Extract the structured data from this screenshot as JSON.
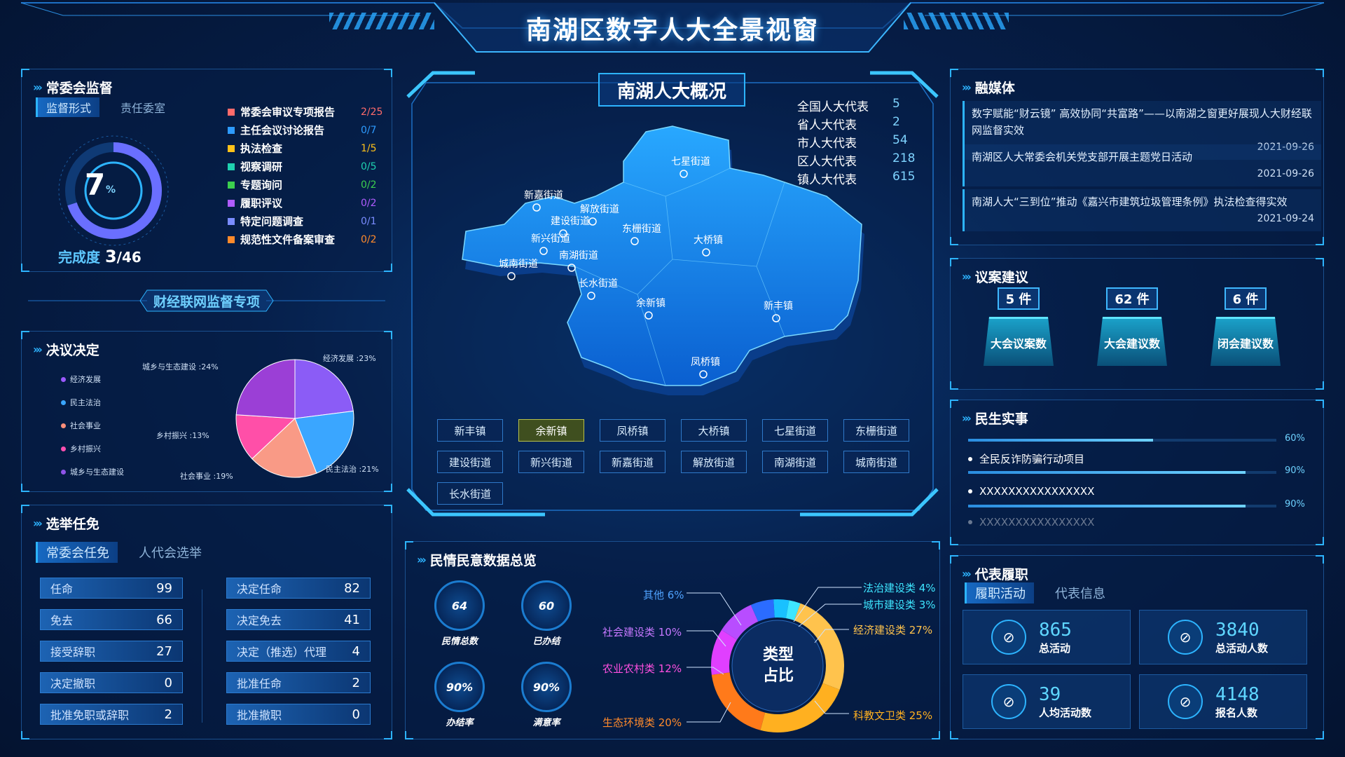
{
  "header": {
    "title": "南湖区数字人大全景视窗"
  },
  "supervision": {
    "title": "常委会监督",
    "tab_active": "监督形式",
    "tab_other": "责任委室",
    "ring_value": "7",
    "ring_unit": "%",
    "ring_percent": 7,
    "completion_label": "完成度",
    "completion_done": "3",
    "completion_total": "/46",
    "items": [
      {
        "label": "常委会审议专项报告",
        "value": "2/25",
        "color": "#ff6b6b"
      },
      {
        "label": "主任会议讨论报告",
        "value": "0/7",
        "color": "#2d9bff"
      },
      {
        "label": "执法检查",
        "value": "1/5",
        "color": "#ffc21a"
      },
      {
        "label": "视察调研",
        "value": "0/5",
        "color": "#1fd1b0"
      },
      {
        "label": "专题询问",
        "value": "0/2",
        "color": "#3ccf4e"
      },
      {
        "label": "履职评议",
        "value": "0/2",
        "color": "#b05cff"
      },
      {
        "label": "特定问题调查",
        "value": "0/1",
        "color": "#7a8cff"
      },
      {
        "label": "规范性文件备案审查",
        "value": "0/2",
        "color": "#ff8a2b"
      }
    ]
  },
  "special_banner": {
    "label": "财经联网监督专项"
  },
  "resolutions": {
    "title": "决议决定",
    "legend": [
      {
        "label": "经济发展",
        "color": "#9b59ff"
      },
      {
        "label": "民主法治",
        "color": "#3aa6ff"
      },
      {
        "label": "社会事业",
        "color": "#ff8f7a"
      },
      {
        "label": "乡村振兴",
        "color": "#ff4fb0"
      },
      {
        "label": "城乡与生态建设",
        "color": "#8f54e8"
      }
    ],
    "pie_labels": {
      "a": "经济发展 :23%",
      "b": "民主法治 :21%",
      "c": "社会事业 :19%",
      "d": "乡村振兴 :13%",
      "e": "城乡与生态建设 :24%"
    }
  },
  "chart_data": [
    {
      "type": "pie",
      "categories": [
        "经济发展",
        "民主法治",
        "社会事业",
        "乡村振兴",
        "城乡与生态建设"
      ],
      "values": [
        23,
        21,
        19,
        13,
        24
      ],
      "colors": [
        "#8b5cf6",
        "#3aa6ff",
        "#f99a86",
        "#ff4fa8",
        "#9b3fd6"
      ]
    },
    {
      "type": "pie",
      "categories": [
        "经济建设类",
        "科教文卫类",
        "生态环境类",
        "农业农村类",
        "社会建设类",
        "其他",
        "法治建设类",
        "城市建设类"
      ],
      "values": [
        27,
        25,
        20,
        12,
        10,
        6,
        4,
        3
      ],
      "colors": [
        "#ffc34d",
        "#ffb020",
        "#ff7a1a",
        "#e03fff",
        "#b84dff",
        "#2b6cff",
        "#19c1ff",
        "#3ee6ff"
      ]
    }
  ],
  "elections": {
    "title": "选举任免",
    "tab_active": "常委会任免",
    "tab_other": "人代会选举",
    "left": [
      {
        "label": "任命",
        "value": "99"
      },
      {
        "label": "免去",
        "value": "66"
      },
      {
        "label": "接受辞职",
        "value": "27"
      },
      {
        "label": "决定撤职",
        "value": "0"
      },
      {
        "label": "批准免职或辞职",
        "value": "2"
      }
    ],
    "right": [
      {
        "label": "决定任命",
        "value": "82"
      },
      {
        "label": "决定免去",
        "value": "41"
      },
      {
        "label": "决定（推选）代理",
        "value": "4"
      },
      {
        "label": "批准任命",
        "value": "2"
      },
      {
        "label": "批准撤职",
        "value": "0"
      }
    ]
  },
  "overview": {
    "title": "南湖人大概况",
    "reps": [
      {
        "label": "全国人大代表",
        "value": "5"
      },
      {
        "label": "省人大代表",
        "value": "2"
      },
      {
        "label": "市人大代表",
        "value": "54"
      },
      {
        "label": "区人大代表",
        "value": "218"
      },
      {
        "label": "镇人大代表",
        "value": "615"
      }
    ],
    "map_places": [
      "七星街道",
      "新嘉街道",
      "解放街道",
      "建设街道",
      "东栅街道",
      "新兴街道",
      "大桥镇",
      "南湖街道",
      "城南街道",
      "长水街道",
      "余新镇",
      "新丰镇",
      "凤桥镇"
    ],
    "buttons": [
      "新丰镇",
      "余新镇",
      "凤桥镇",
      "大桥镇",
      "七星街道",
      "东栅街道",
      "建设街道",
      "新兴街道",
      "新嘉街道",
      "解放街道",
      "南湖街道",
      "城南街道",
      "长水街道"
    ]
  },
  "public_opinion": {
    "title": "民情民意数据总览",
    "kpis": [
      {
        "value": "64",
        "label": "民情总数"
      },
      {
        "value": "60",
        "label": "已办结"
      },
      {
        "value": "90%",
        "label": "办结率"
      },
      {
        "value": "90%",
        "label": "满意率"
      }
    ],
    "donut_center_1": "类型",
    "donut_center_2": "占比",
    "labels": {
      "l1": "其他 6%",
      "l2": "社会建设类 10%",
      "l3": "农业农村类 12%",
      "l4": "生态环境类 20%",
      "r1": "法治建设类 4%",
      "r2": "城市建设类 3%",
      "r3": "经济建设类 27%",
      "r4": "科教文卫类 25%"
    }
  },
  "media": {
    "title": "融媒体",
    "news": [
      {
        "text": "数字赋能“财云镜” 高效协同“共富路”——以南湖之窗更好展现人大财经联网监督实效",
        "date": "2021-09-26"
      },
      {
        "text": "南湖区人大常委会机关党支部开展主题党日活动",
        "date": "2021-09-26"
      },
      {
        "text": "南湖人大“三到位”推动《嘉兴市建筑垃圾管理条例》执法检查得实效",
        "date": "2021-09-24"
      }
    ]
  },
  "proposals": {
    "title": "议案建议",
    "items": [
      {
        "count": "5 件",
        "label": "大会议案数"
      },
      {
        "count": "62 件",
        "label": "大会建议数"
      },
      {
        "count": "6 件",
        "label": "闭会建议数"
      }
    ]
  },
  "livelihood": {
    "title": "民生实事",
    "items": [
      {
        "label": "",
        "pct": "60%",
        "fill": 0.6
      },
      {
        "label": "全民反诈防骗行动项目",
        "pct": "90%",
        "fill": 0.9
      },
      {
        "label": "XXXXXXXXXXXXXXXX",
        "pct": "90%",
        "fill": 0.9
      },
      {
        "label": "XXXXXXXXXXXXXXXX",
        "pct": "",
        "fill": 0
      }
    ]
  },
  "duties": {
    "title": "代表履职",
    "tab_active": "履职活动",
    "tab_other": "代表信息",
    "cards": [
      {
        "value": "865",
        "label": "总活动"
      },
      {
        "value": "3840",
        "label": "总活动人数"
      },
      {
        "value": "39",
        "label": "人均活动数"
      },
      {
        "value": "4148",
        "label": "报名人数"
      }
    ]
  }
}
